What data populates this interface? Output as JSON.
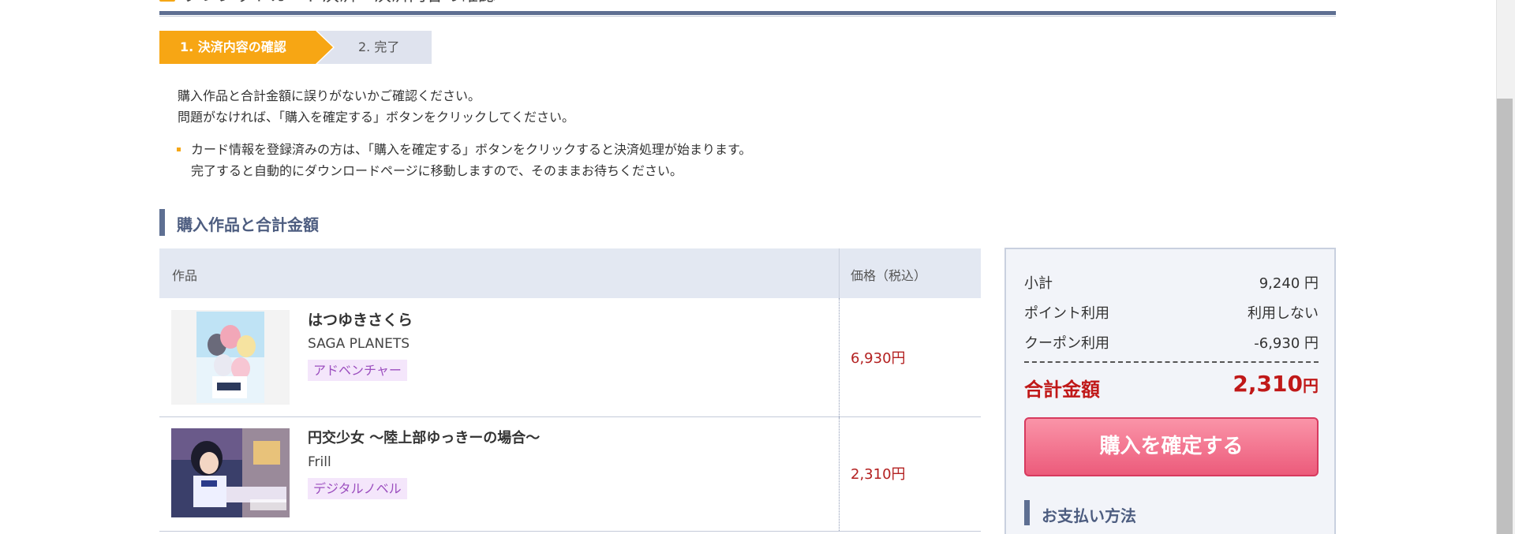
{
  "header": {
    "title_partial": "クレジットカード決済・決済内容の確認"
  },
  "steps": [
    {
      "label": "1. 決済内容の確認"
    },
    {
      "label": "2. 完了"
    }
  ],
  "instructions": {
    "line1": "購入作品と合計金額に誤りがないかご確認ください。",
    "line2": "問題がなければ、「購入を確定する」ボタンをクリックしてください。"
  },
  "notice": {
    "line1": "カード情報を登録済みの方は、「購入を確定する」ボタンをクリックすると決済処理が始まります。",
    "line2": "完了すると自動的にダウンロードページに移動しますので、そのままお待ちください。"
  },
  "section_title": "購入作品と合計金額",
  "table": {
    "col_item": "作品",
    "col_price": "価格（税込）",
    "rows": [
      {
        "title": "はつゆきさくら",
        "brand": "SAGA PLANETS",
        "genre": "アドベンチャー",
        "price": "6,930円"
      },
      {
        "title": "円交少女 ～陸上部ゆっきーの場合～",
        "brand": "Frill",
        "genre": "デジタルノベル",
        "price": "2,310円"
      }
    ]
  },
  "summary": {
    "subtotal_label": "小計",
    "subtotal_value": "9,240 円",
    "points_label": "ポイント利用",
    "points_value": "利用しない",
    "coupon_label": "クーポン利用",
    "coupon_value": "-6,930 円",
    "total_label": "合計金額",
    "total_value": "2,310",
    "total_unit": "円",
    "buy_button": "購入を確定する",
    "payment_heading": "お支払い方法"
  },
  "colors": {
    "accent_orange": "#f7a614",
    "navy": "#5e6f92",
    "price_red": "#b32020",
    "total_red": "#c01818",
    "buy_button": "#ec5b7b"
  }
}
